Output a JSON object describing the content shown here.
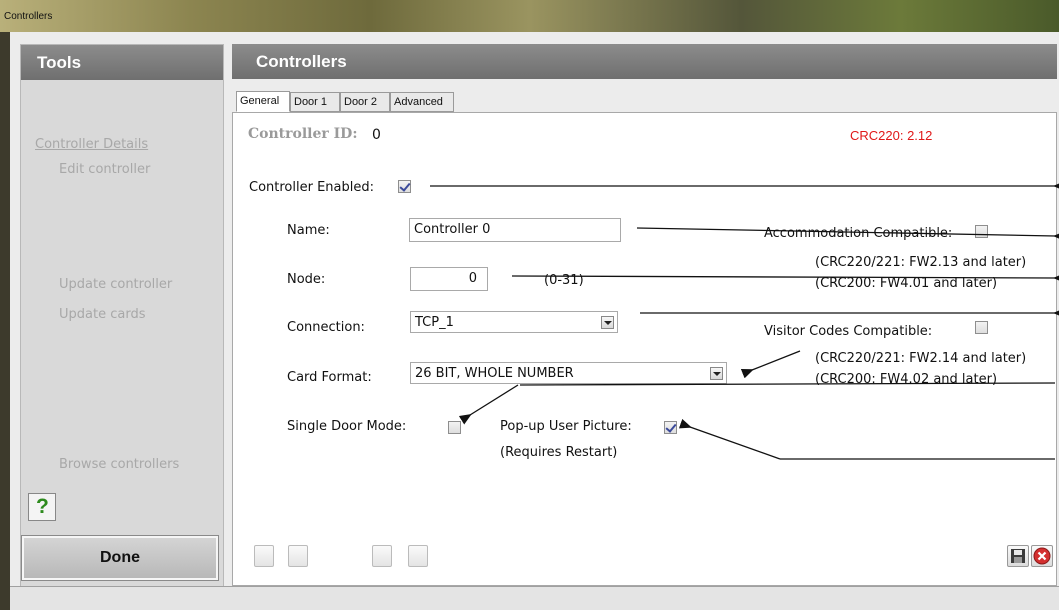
{
  "window": {
    "title": "Controllers"
  },
  "sidebar": {
    "header": "Tools",
    "items": [
      {
        "label": "Controller Details"
      },
      {
        "label": "Edit controller"
      },
      {
        "label": "Update controller"
      },
      {
        "label": "Update cards"
      },
      {
        "label": "Browse controllers"
      }
    ],
    "help_icon": "question-icon",
    "done_label": "Done"
  },
  "main": {
    "header": "Controllers",
    "tabs": [
      {
        "label": "General",
        "active": true
      },
      {
        "label": "Door 1",
        "active": false
      },
      {
        "label": "Door 2",
        "active": false
      },
      {
        "label": "Advanced",
        "active": false
      }
    ],
    "controller_id_label": "Controller ID:",
    "controller_id_value": "0",
    "firmware_version": "CRC220: 2.12",
    "controller_enabled_label": "Controller Enabled:",
    "controller_enabled_checked": true,
    "name_label": "Name:",
    "name_value": "Controller 0",
    "node_label": "Node:",
    "node_value": "0",
    "node_range": "(0-31)",
    "connection_label": "Connection:",
    "connection_value": "TCP_1",
    "card_format_label": "Card Format:",
    "card_format_value": "26 BIT, WHOLE NUMBER",
    "single_door_label": "Single Door Mode:",
    "single_door_checked": false,
    "popup_picture_label": "Pop-up User Picture:",
    "popup_picture_checked": true,
    "requires_restart": "(Requires Restart)",
    "accommodation_label": "Accommodation Compatible:",
    "accommodation_checked": false,
    "accommodation_note1": "(CRC220/221: FW2.13 and later)",
    "accommodation_note2": "(CRC200: FW4.01 and later)",
    "visitor_label": "Visitor Codes Compatible:",
    "visitor_checked": false,
    "visitor_note1": "(CRC220/221: FW2.14 and later)",
    "visitor_note2": "(CRC200: FW4.02 and later)",
    "save_icon": "save-icon",
    "cancel_icon": "cancel-icon"
  },
  "colors": {
    "header_gray": "#7d7d7d",
    "accent_red": "#e01818",
    "check_blue": "#3b4a9a"
  }
}
